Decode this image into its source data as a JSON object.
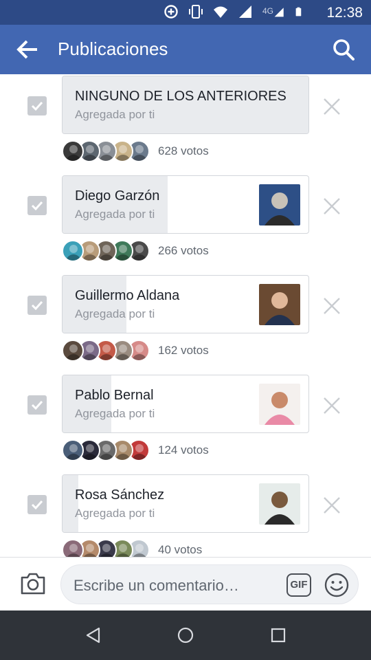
{
  "status_bar": {
    "time": "12:38",
    "network": "4G",
    "icons": [
      "data-saver-icon",
      "vibrate-icon",
      "wifi-icon",
      "signal-icon",
      "signal-4g-icon",
      "battery-icon"
    ]
  },
  "app_bar": {
    "title": "Publicaciones",
    "back_icon": "arrow-left-icon",
    "search_icon": "search-icon"
  },
  "poll": {
    "options": [
      {
        "name": "NINGUNO DE LOS ANTERIORES",
        "added_by": "Agregada por ti",
        "votes_label": "628 votos",
        "votes": 628,
        "fill": 1.0,
        "checked": true,
        "has_photo": false,
        "photo_colors": [],
        "voter_colors": [
          "#3a3a3a",
          "#5c6670",
          "#8a8f96",
          "#c9b38a",
          "#6b7a8c"
        ]
      },
      {
        "name": "Diego Garzón",
        "added_by": "Agregada por ti",
        "votes_label": "266 votos",
        "votes": 266,
        "fill": 0.424,
        "checked": true,
        "has_photo": true,
        "photo_colors": [
          "#2d4f86",
          "#c8c2b8",
          "#2b2b2b"
        ],
        "voter_colors": [
          "#3aa0b8",
          "#b89c7a",
          "#6e6458",
          "#3f7a5a",
          "#4a4a4a"
        ]
      },
      {
        "name": "Guillermo Aldana",
        "added_by": "Agregada por ti",
        "votes_label": "162 votos",
        "votes": 162,
        "fill": 0.258,
        "checked": true,
        "has_photo": true,
        "photo_colors": [
          "#6a4a32",
          "#e0b89a",
          "#23324f"
        ],
        "voter_colors": [
          "#5a4a3e",
          "#7b6a88",
          "#c45a48",
          "#9a8c80",
          "#d68a88"
        ]
      },
      {
        "name": "Pablo Bernal",
        "added_by": "Agregada por ti",
        "votes_label": "124 votos",
        "votes": 124,
        "fill": 0.198,
        "checked": true,
        "has_photo": true,
        "photo_colors": [
          "#f4f0ee",
          "#c98a6a",
          "#e98aa6"
        ],
        "voter_colors": [
          "#4a5e78",
          "#2a2a3a",
          "#6a6a6a",
          "#a88a6a",
          "#c23a3a"
        ]
      },
      {
        "name": "Rosa Sánchez",
        "added_by": "Agregada por ti",
        "votes_label": "40 votos",
        "votes": 40,
        "fill": 0.064,
        "checked": true,
        "has_photo": true,
        "photo_colors": [
          "#e6ecea",
          "#7a5a3e",
          "#2a2a2a"
        ],
        "voter_colors": [
          "#8a6a78",
          "#b48a6a",
          "#3a3a4a",
          "#7a8a5a",
          "#c0c8d0"
        ]
      }
    ]
  },
  "composer": {
    "placeholder": "Escribe un comentario…",
    "gif_label": "GIF",
    "camera_icon": "camera-icon",
    "emoji_icon": "emoji-icon"
  },
  "nav_bar": {
    "buttons": [
      "back-triangle-icon",
      "home-circle-icon",
      "recents-square-icon"
    ]
  },
  "colors": {
    "status_bar": "#2d4a86",
    "app_bar": "#4267b2",
    "checkbox": "#c9ccd1",
    "vote_fill": "#e9ebee",
    "nav_bar": "#2f3339"
  }
}
